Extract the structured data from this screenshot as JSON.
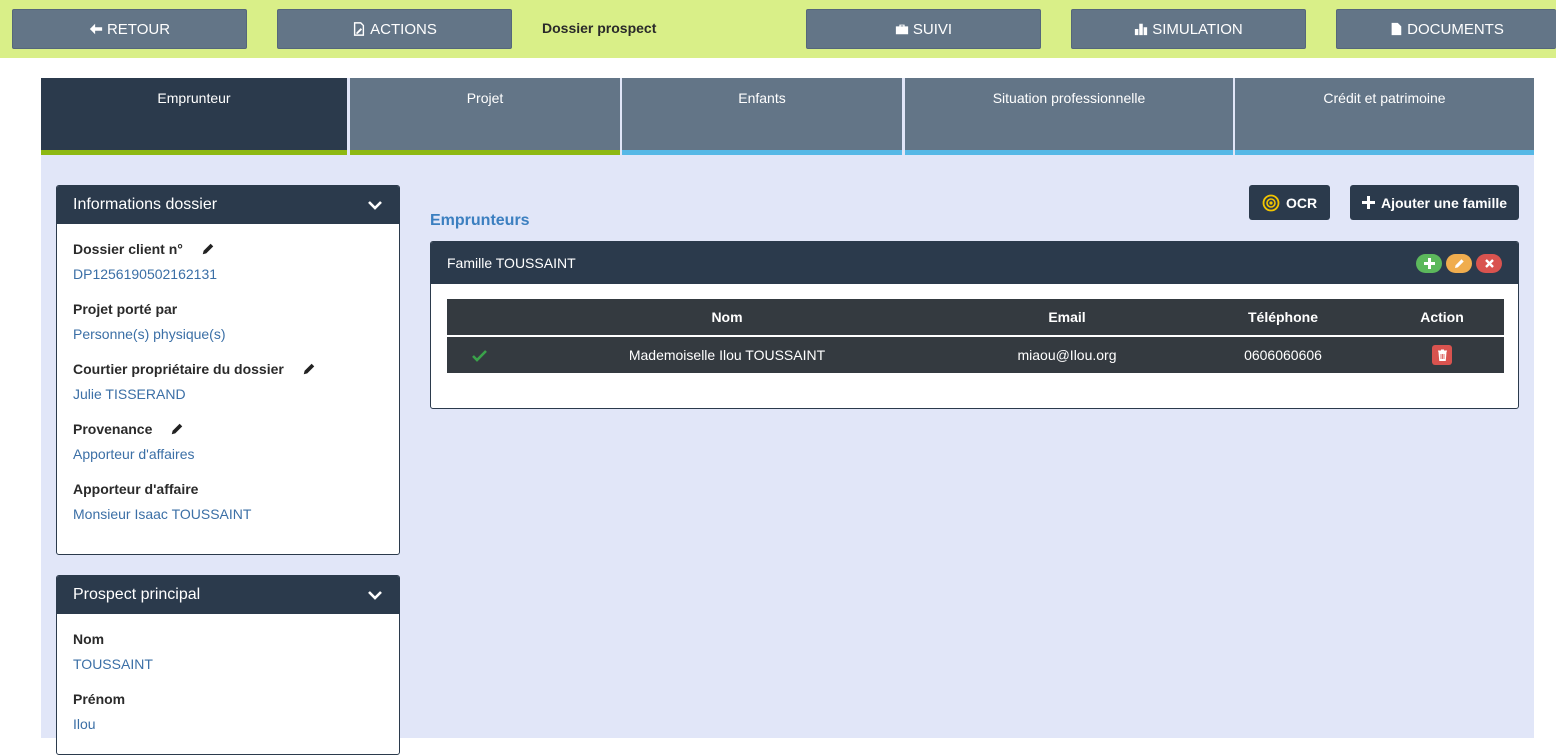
{
  "topbar": {
    "title": "Dossier prospect",
    "buttons": [
      {
        "label": "RETOUR",
        "icon": "arrow-left-icon"
      },
      {
        "label": "ACTIONS",
        "icon": "file-edit-icon"
      },
      {
        "label": "SUIVI",
        "icon": "briefcase-icon"
      },
      {
        "label": "SIMULATION",
        "icon": "bar-chart-icon"
      },
      {
        "label": "DOCUMENTS",
        "icon": "document-icon"
      }
    ]
  },
  "tabs": [
    {
      "label": "Emprunteur",
      "active": true
    },
    {
      "label": "Projet"
    },
    {
      "label": "Enfants"
    },
    {
      "label": "Situation professionnelle"
    },
    {
      "label": "Crédit et patrimoine"
    }
  ],
  "colors": {
    "topbar_bg": "#d9ef88",
    "button_bg": "#637587",
    "active_tab": "#2b3a4c",
    "tab_bar_done": "#8db813",
    "tab_bar_todo": "#56b8e6",
    "content_bg": "#e1e6f8",
    "link": "#3b6fa6"
  },
  "info_panel": {
    "title": "Informations dossier",
    "fields": [
      {
        "label": "Dossier client n°",
        "value": "DP1256190502162131"
      },
      {
        "label": "Projet porté par",
        "value": "Personne(s) physique(s)"
      },
      {
        "label": "Courtier propriétaire du dossier",
        "value": "Julie TISSERAND"
      },
      {
        "label": "Provenance",
        "value": "Apporteur d'affaires"
      },
      {
        "label": "Apporteur d'affaire",
        "value": "Monsieur Isaac TOUSSAINT"
      }
    ]
  },
  "prospect_panel": {
    "title": "Prospect principal",
    "fields": [
      {
        "label": "Nom",
        "value": "TOUSSAINT"
      },
      {
        "label": "Prénom",
        "value": "Ilou"
      }
    ]
  },
  "borrowers": {
    "section_title": "Emprunteurs",
    "ocr_label": "OCR",
    "add_family_label": "Ajouter une famille",
    "family_title": "Famille TOUSSAINT",
    "table_headers": [
      "Nom",
      "Email",
      "Téléphone",
      "Action"
    ],
    "rows": [
      {
        "nom": "Mademoiselle Ilou TOUSSAINT",
        "email": "miaou@Ilou.org",
        "telephone": "0606060606"
      }
    ]
  }
}
